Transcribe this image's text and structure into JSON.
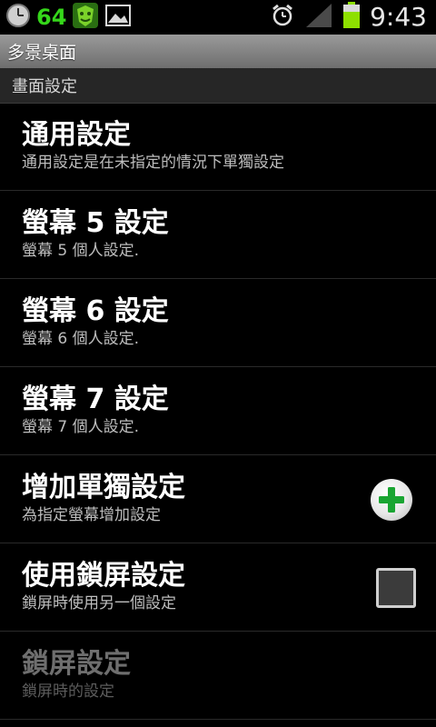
{
  "status_bar": {
    "battery_level": "64",
    "time": "9:43",
    "icons": [
      "clock-icon",
      "battery-app-icon",
      "image-icon",
      "alarm-icon",
      "signal-icon",
      "battery-icon"
    ]
  },
  "app": {
    "title": "多景桌面"
  },
  "category": {
    "label": "畫面設定"
  },
  "prefs": [
    {
      "title": "通用設定",
      "summary": "通用設定是在未指定的情況下單獨設定"
    },
    {
      "title": "螢幕 5 設定",
      "summary": "螢幕 5 個人設定."
    },
    {
      "title": "螢幕 6 設定",
      "summary": "螢幕 6 個人設定."
    },
    {
      "title": "螢幕 7 設定",
      "summary": "螢幕 7 個人設定."
    },
    {
      "title": "增加單獨設定",
      "summary": "為指定螢幕增加設定",
      "widget": "add-icon"
    },
    {
      "title": "使用鎖屏設定",
      "summary": "鎖屏時使用另一個設定",
      "widget": "checkbox",
      "checked": false
    },
    {
      "title": "鎖屏設定",
      "summary": "鎖屏時的設定",
      "enabled": false
    }
  ],
  "colors": {
    "accent_green": "#35d61a",
    "add_plus_green": "#1aa532",
    "battery_green": "#8ee000"
  }
}
